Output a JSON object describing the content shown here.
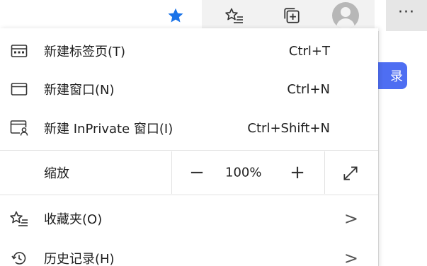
{
  "toolbar": {
    "more_label": "···"
  },
  "page": {
    "login_button_text": "录"
  },
  "menu": {
    "items": [
      {
        "label": "新建标签页(T)",
        "shortcut": "Ctrl+T"
      },
      {
        "label": "新建窗口(N)",
        "shortcut": "Ctrl+N"
      },
      {
        "label": "新建 InPrivate 窗口(I)",
        "shortcut": "Ctrl+Shift+N"
      }
    ],
    "zoom": {
      "label": "缩放",
      "minus": "−",
      "value": "100%",
      "plus": "+"
    },
    "bottom_items": [
      {
        "label": "收藏夹(O)",
        "chevron": ">"
      },
      {
        "label": "历史记录(H)",
        "chevron": ">"
      }
    ]
  },
  "colors": {
    "accent_star": "#1a73e8",
    "login_button": "#4e6ef2",
    "toolbar_active": "#f2f2f2"
  }
}
